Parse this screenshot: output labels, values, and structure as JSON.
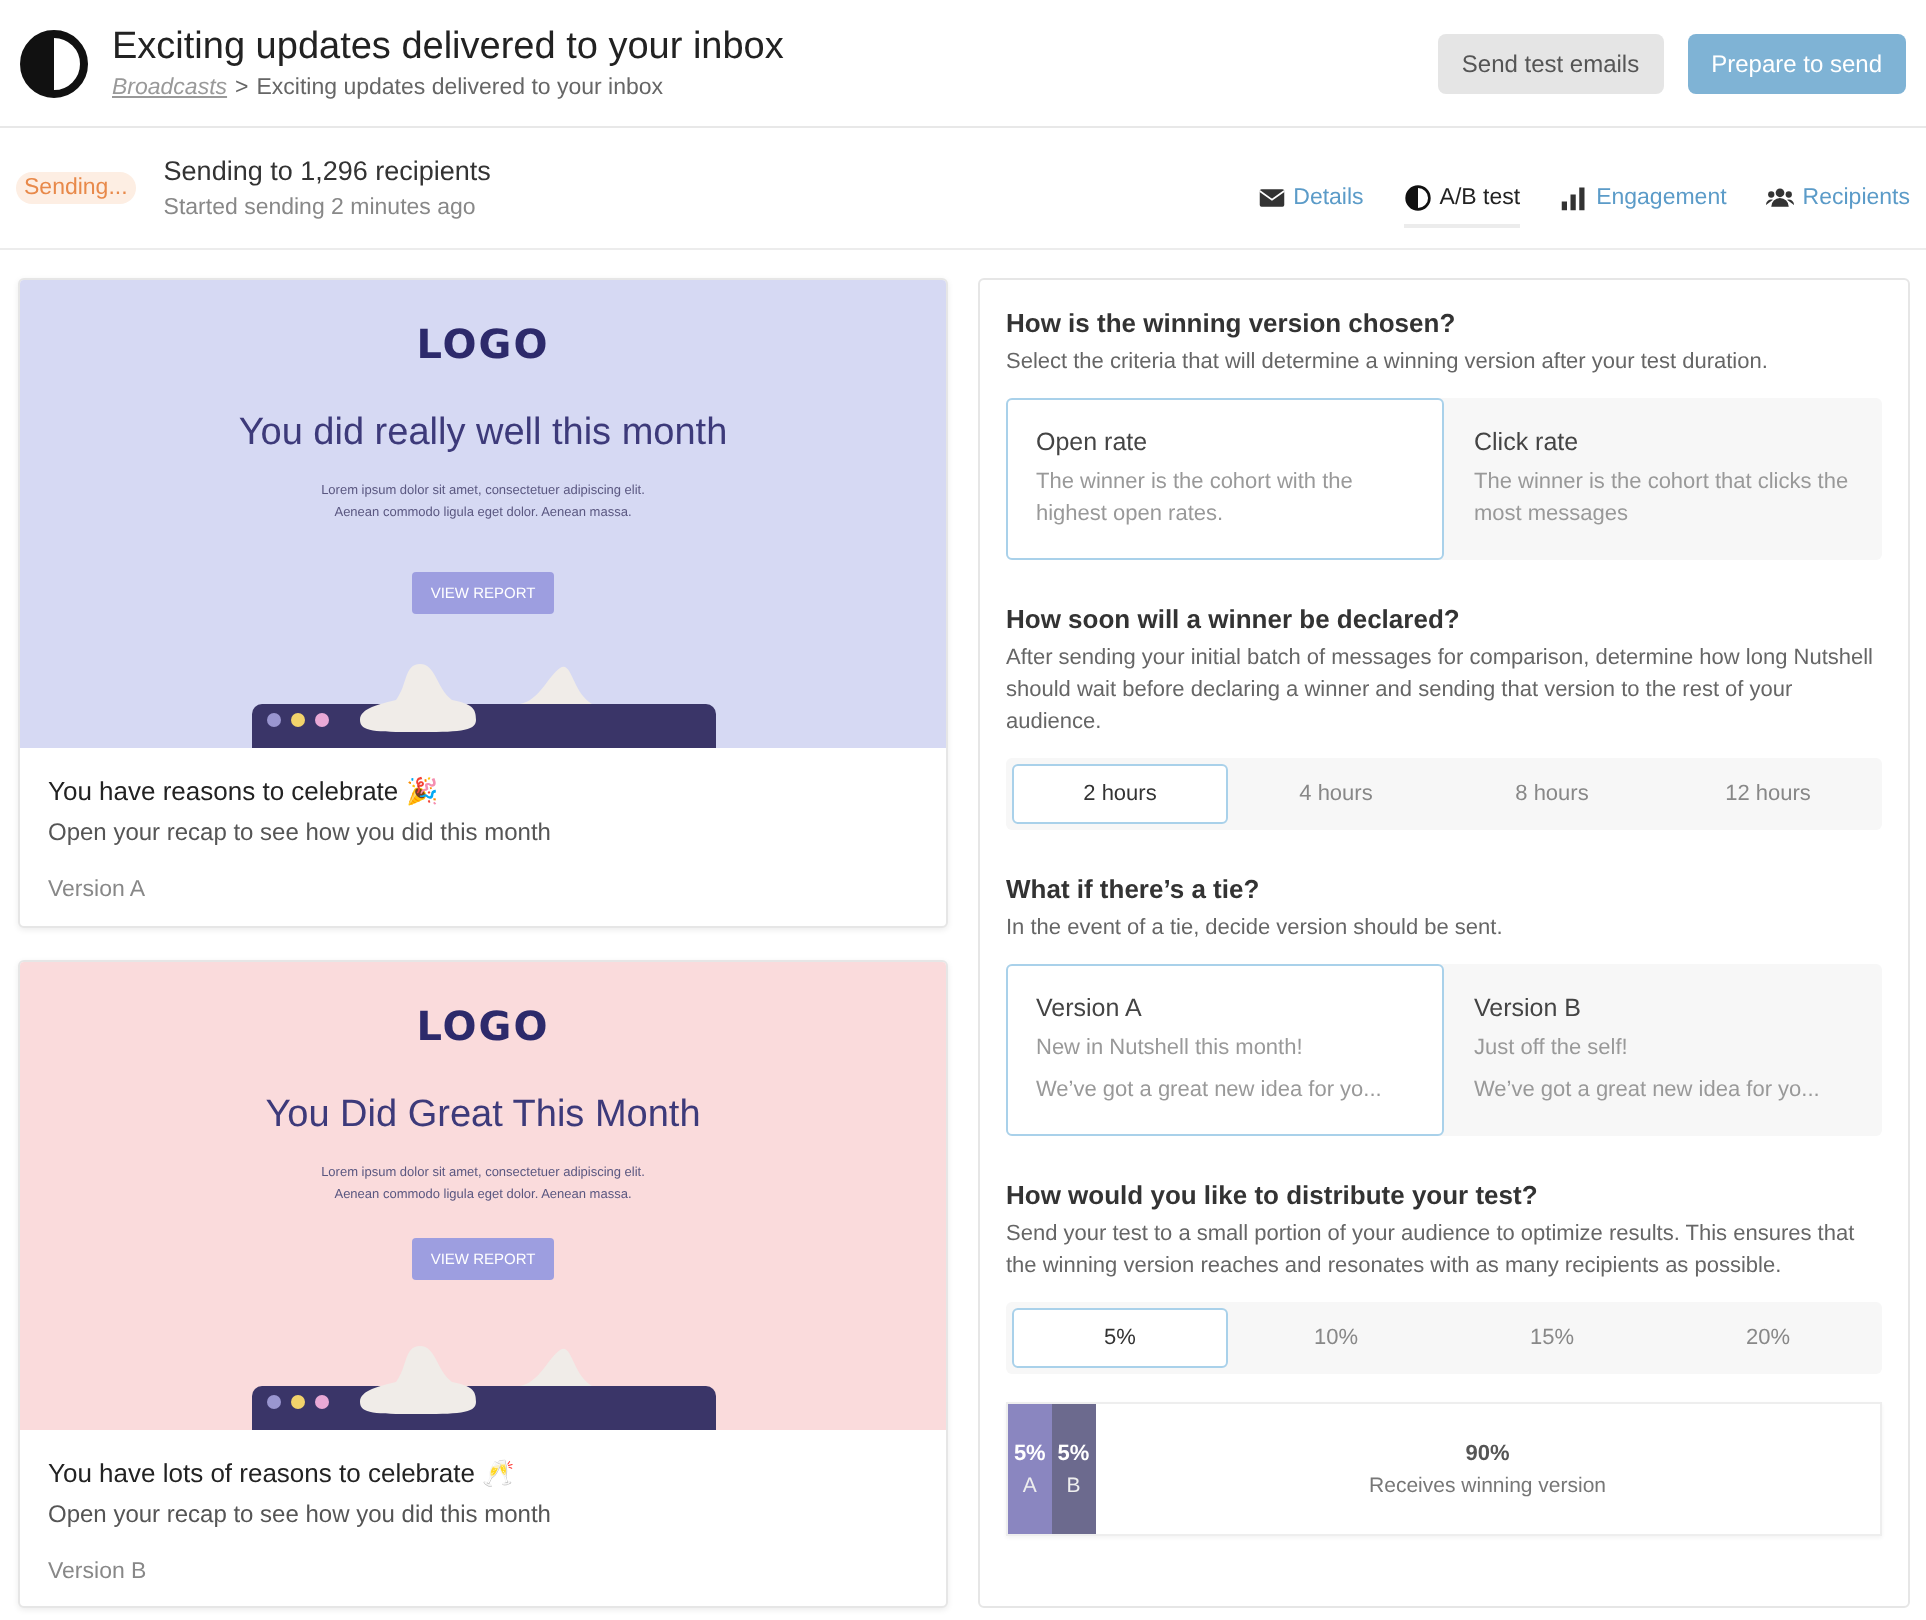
{
  "header": {
    "title": "Exciting updates delivered to your inbox",
    "breadcrumb": {
      "link": "Broadcasts",
      "separator": ">",
      "current": "Exciting updates delivered to your inbox"
    },
    "buttons": [
      {
        "label": "Send test emails",
        "kind": "secondary"
      },
      {
        "label": "Prepare to send",
        "kind": "primary"
      }
    ]
  },
  "status": {
    "badge": "Sending...",
    "title": "Sending to 1,296 recipients",
    "subtitle": "Started sending 2 minutes ago"
  },
  "tabs": [
    {
      "label": "Details",
      "kind": "mail",
      "selected": false
    },
    {
      "label": "A/B test",
      "kind": "contrast",
      "selected": true
    },
    {
      "label": "Engagement",
      "kind": "chart",
      "selected": false
    },
    {
      "label": "Recipients",
      "kind": "people",
      "selected": false
    }
  ],
  "versions": [
    {
      "color": "#d6d9f3",
      "logo": "LOGO",
      "headline": "You did really well this month",
      "body": [
        "Lorem ipsum dolor sit amet, consectetuer adipiscing elit.",
        "Aenean commodo ligula eget dolor. Aenean massa."
      ],
      "cta": "VIEW REPORT",
      "subject": "You have reasons to celebrate 🎉",
      "preview": "Open your recap to see how you did this month",
      "label": "Version A"
    },
    {
      "color": "#fadbdc",
      "logo": "LOGO",
      "headline": "You Did Great This Month",
      "body": [
        "Lorem ipsum dolor sit amet, consectetuer adipiscing elit.",
        "Aenean commodo ligula eget dolor. Aenean massa."
      ],
      "cta": "VIEW REPORT",
      "subject": "You have lots of reasons to celebrate 🥂",
      "preview": "Open your recap to see how you did this month",
      "label": "Version B"
    }
  ],
  "settings": [
    {
      "kind": "cards",
      "question": "How is the winning version chosen?",
      "description": "Select the criteria that will determine a winning version after your test duration.",
      "options": [
        {
          "title": "Open rate",
          "lines": [
            "The winner is the cohort with the highest open rates."
          ],
          "selected": true
        },
        {
          "title": "Click rate",
          "lines": [
            "The winner is the cohort that clicks the most messages"
          ],
          "selected": false
        }
      ]
    },
    {
      "kind": "segments",
      "question": "How soon will a winner be declared?",
      "description": "After sending your initial batch of messages for comparison, determine how long Nutshell should wait before declaring a winner and sending that version to the rest of your audience.",
      "options": [
        {
          "title": "2 hours",
          "selected": true
        },
        {
          "title": "4 hours",
          "selected": false
        },
        {
          "title": "8 hours",
          "selected": false
        },
        {
          "title": "12 hours",
          "selected": false
        }
      ]
    },
    {
      "kind": "cards",
      "question": "What if there’s a tie?",
      "description": "In the event of a tie, decide version should be sent.",
      "options": [
        {
          "title": "Version A",
          "lines": [
            "New in Nutshell this month!",
            "We’ve got a great new idea for yo..."
          ],
          "selected": true
        },
        {
          "title": "Version B",
          "lines": [
            "Just off the self!",
            "We’ve got a great new idea for yo..."
          ],
          "selected": false
        }
      ]
    },
    {
      "kind": "segments",
      "question": "How would you like to distribute your test?",
      "description": "Send your test to a small portion of your audience to optimize results. This ensures that the winning version reaches and resonates with as many recipients as possible.",
      "options": [
        {
          "title": "5%",
          "selected": true
        },
        {
          "title": "10%",
          "selected": false
        },
        {
          "title": "15%",
          "selected": false
        },
        {
          "title": "20%",
          "selected": false
        }
      ]
    }
  ],
  "distribution": [
    {
      "value": "5%",
      "caption": "A",
      "level": 0.05,
      "color": "#8a86c0"
    },
    {
      "value": "5%",
      "caption": "B",
      "level": 0.05,
      "color": "#6c6a8e"
    },
    {
      "value": "90%",
      "caption": "Receives winning version",
      "level": 0.9,
      "color": "#ffffff"
    }
  ]
}
